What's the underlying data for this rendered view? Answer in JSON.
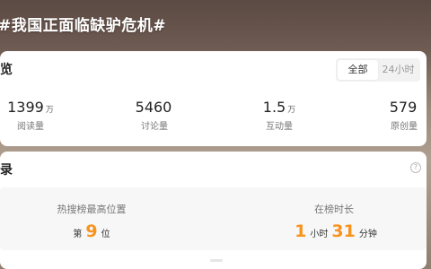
{
  "header": {
    "hashtag_title": "#我国正面临缺驴危机#"
  },
  "overview": {
    "title": "览",
    "tabs": [
      {
        "label": "全部",
        "active": true
      },
      {
        "label": "24小时",
        "active": false
      }
    ],
    "stats": [
      {
        "value": "1399",
        "unit": "万",
        "label": "阅读量"
      },
      {
        "value": "5460",
        "unit": "",
        "label": "讨论量"
      },
      {
        "value": "1.5",
        "unit": "万",
        "label": "互动量"
      },
      {
        "value": "579",
        "unit": "",
        "label": "原创量"
      }
    ]
  },
  "record": {
    "title": "录",
    "help_icon": "?",
    "metrics": {
      "highest_rank": {
        "label": "热搜榜最高位置",
        "prefix": "第",
        "value": "9",
        "suffix": "位"
      },
      "duration": {
        "label": "在榜时长",
        "hours": "1",
        "hours_unit": "小时",
        "minutes": "31",
        "minutes_unit": "分钟"
      }
    }
  },
  "colors": {
    "accent_orange": "#f7931e"
  }
}
